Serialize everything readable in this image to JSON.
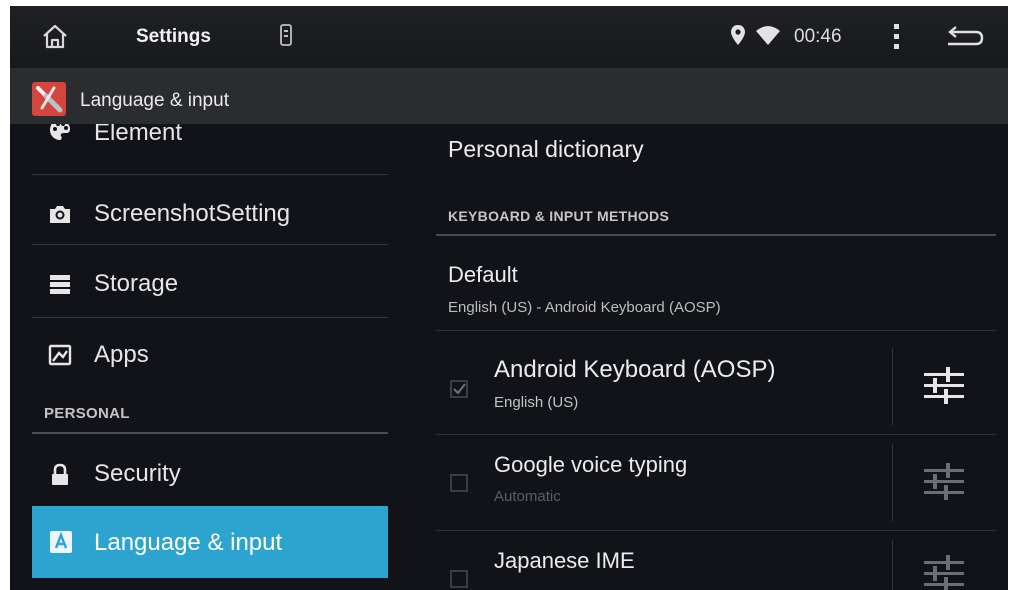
{
  "status_bar": {
    "title": "Settings",
    "time": "00:46",
    "icons": [
      "home-icon",
      "sd-card-icon",
      "location-icon",
      "wifi-icon",
      "overflow-menu-icon",
      "back-icon"
    ]
  },
  "app_bar": {
    "title": "Language & input",
    "logo_icon": "settings-wrench-icon"
  },
  "sidebar": {
    "items": [
      {
        "label": "Element",
        "icon": "palette-icon"
      },
      {
        "label": "ScreenshotSetting",
        "icon": "camera-icon"
      },
      {
        "label": "Storage",
        "icon": "storage-icon"
      },
      {
        "label": "Apps",
        "icon": "apps-icon"
      }
    ],
    "section_header": "PERSONAL",
    "personal_items": [
      {
        "label": "Security",
        "icon": "lock-icon"
      },
      {
        "label": "Language & input",
        "icon": "language-icon",
        "selected": true
      }
    ],
    "selected_color": "#2da3d0"
  },
  "main": {
    "personal_dictionary": "Personal dictionary",
    "section_header": "KEYBOARD & INPUT METHODS",
    "default": {
      "title": "Default",
      "summary": "English (US) - Android Keyboard (AOSP)"
    },
    "input_methods": [
      {
        "name": "Android Keyboard (AOSP)",
        "summary": "English (US)",
        "checked": true
      },
      {
        "name": "Google voice typing",
        "summary": "Automatic",
        "checked": false
      },
      {
        "name": "Japanese IME",
        "summary": "",
        "checked": false
      }
    ]
  }
}
